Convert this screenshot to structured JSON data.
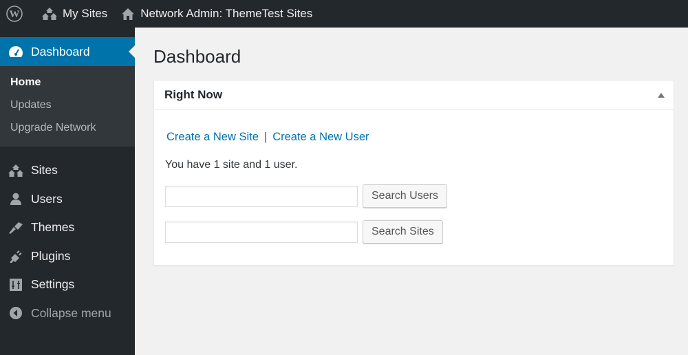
{
  "adminbar": {
    "wp_logo": "wordpress-logo",
    "my_sites": "My Sites",
    "network_admin": "Network Admin: ThemeTest Sites"
  },
  "sidebar": {
    "dashboard": "Dashboard",
    "submenu": [
      "Home",
      "Updates",
      "Upgrade Network"
    ],
    "items": [
      {
        "label": "Sites",
        "icon": "sites-icon"
      },
      {
        "label": "Users",
        "icon": "users-icon"
      },
      {
        "label": "Themes",
        "icon": "themes-icon"
      },
      {
        "label": "Plugins",
        "icon": "plugins-icon"
      },
      {
        "label": "Settings",
        "icon": "settings-icon"
      }
    ],
    "collapse": "Collapse menu"
  },
  "main": {
    "title": "Dashboard",
    "widget": {
      "title": "Right Now",
      "link_site": "Create a New Site",
      "separator": "|",
      "link_user": "Create a New User",
      "count_text": "You have 1 site and 1 user.",
      "search_users_value": "",
      "search_users_button": "Search Users",
      "search_sites_value": "",
      "search_sites_button": "Search Sites"
    }
  }
}
